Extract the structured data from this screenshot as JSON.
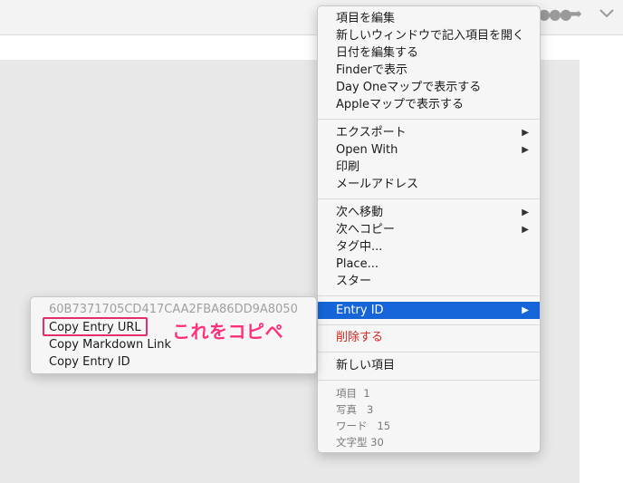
{
  "menu": {
    "items": [
      {
        "label": "項目を編集",
        "submenu": false
      },
      {
        "label": "新しいウィンドウで記入項目を開く",
        "submenu": false
      },
      {
        "label": "日付を編集する",
        "submenu": false
      },
      {
        "label": "Finderで表示",
        "submenu": false
      },
      {
        "label": "Day Oneマップで表示する",
        "submenu": false
      },
      {
        "label": "Appleマップで表示する",
        "submenu": false
      },
      {
        "label": "エクスポート",
        "submenu": true
      },
      {
        "label": "Open With",
        "submenu": true
      },
      {
        "label": "印刷",
        "submenu": false
      },
      {
        "label": "メールアドレス",
        "submenu": false
      },
      {
        "label": "次へ移動",
        "submenu": true
      },
      {
        "label": "次へコピー",
        "submenu": true
      },
      {
        "label": "タグ中...",
        "submenu": false
      },
      {
        "label": "Place...",
        "submenu": false
      },
      {
        "label": "スター",
        "submenu": false
      },
      {
        "label": "Entry ID",
        "submenu": true,
        "highlighted": true
      },
      {
        "label": "削除する",
        "submenu": false,
        "danger": true
      },
      {
        "label": "新しい項目",
        "submenu": false
      }
    ],
    "stats": [
      {
        "label": "項目",
        "value": "1"
      },
      {
        "label": "写真",
        "value": "3"
      },
      {
        "label": "ワード",
        "value": "15"
      },
      {
        "label": "文字型",
        "value": "30"
      }
    ]
  },
  "submenu": {
    "entry_id": "60B7371705CD417CAA2FBA86DD9A8050",
    "items": [
      "Copy Entry URL",
      "Copy Markdown Link",
      "Copy Entry ID"
    ]
  },
  "annotation": "これをコピペ",
  "arrow_glyph": "▶",
  "colors": {
    "highlight": "#1565d8",
    "danger": "#d0271f",
    "annotation": "#ff2f79"
  }
}
